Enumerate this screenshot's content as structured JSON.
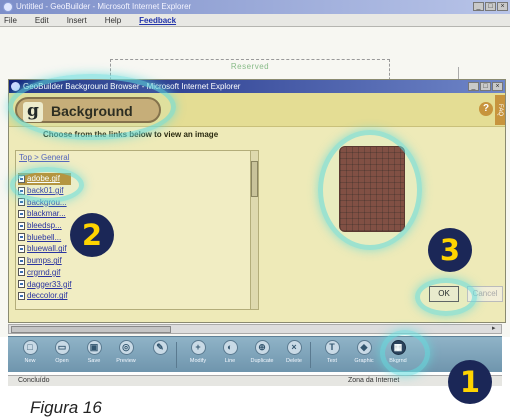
{
  "outer_window": {
    "title": "Untitled - GeoBuilder - Microsoft Internet Explorer",
    "menu": [
      "File",
      "Edit",
      "Insert",
      "Help",
      "Feedback"
    ],
    "reserved_label": "Reserved",
    "status": "Concluído",
    "zone": "Zona da Internet"
  },
  "dialog": {
    "title": "GeoBuilder Background Browser - Microsoft Internet Explorer",
    "logo_letter": "g",
    "heading": "Background",
    "help_glyph": "?",
    "help_tag": "FAQ",
    "instruction": "Choose from the links below to view an image",
    "breadcrumb": "Top > General",
    "files": [
      "adobe.gif",
      "back01.gif",
      "backgrou...",
      "blackmar...",
      "bleedsp...",
      "bluebell...",
      "bluewall.gif",
      "bumps.gif",
      "crgrnd.gif",
      "dagger33.gif",
      "deccolor.gif"
    ],
    "selected_index": 0,
    "ok_label": "OK",
    "cancel_label": "Cancel"
  },
  "toolbar": {
    "tools": [
      {
        "label": "New",
        "glyph": "□"
      },
      {
        "label": "Open",
        "glyph": "▭"
      },
      {
        "label": "Save",
        "glyph": "▣"
      },
      {
        "label": "Preview",
        "glyph": "◎"
      },
      {
        "label": "",
        "glyph": "✎"
      },
      {
        "label": "Modify",
        "glyph": "+"
      },
      {
        "label": "Line",
        "glyph": "◐"
      },
      {
        "label": "Duplicate",
        "glyph": "⊕"
      },
      {
        "label": "Delete",
        "glyph": "×"
      },
      {
        "label": "Text",
        "glyph": "T"
      },
      {
        "label": "Graphic",
        "glyph": "◆"
      },
      {
        "label": "Bkgrnd",
        "glyph": "▦"
      }
    ],
    "active_index": 11
  },
  "callouts": [
    "1",
    "2",
    "3"
  ],
  "caption": "Figura 16"
}
